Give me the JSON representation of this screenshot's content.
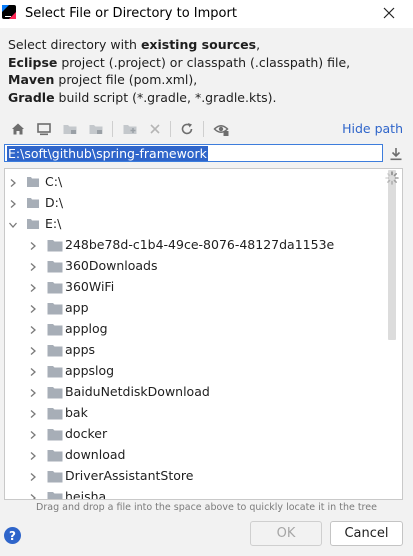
{
  "window": {
    "title": "Select File or Directory to Import"
  },
  "description": {
    "line1_pre": "Select directory with ",
    "line1_bold": "existing sources",
    "line1_post": ",",
    "line2_bold": "Eclipse",
    "line2_post": " project (.project) or classpath (.classpath) file,",
    "line3_bold": "Maven",
    "line3_post": " project file (pom.xml),",
    "line4_bold": "Gradle",
    "line4_post": " build script (*.gradle, *.gradle.kts)."
  },
  "toolbar": {
    "icons": [
      "home-icon",
      "desktop-icon",
      "project-folder-icon",
      "module-folder-icon",
      "new-folder-icon",
      "delete-icon",
      "refresh-icon",
      "show-hidden-icon"
    ],
    "hide_path_label": "Hide path"
  },
  "path_field": {
    "value": "E:\\soft\\github\\spring-framework"
  },
  "tree": {
    "drives": [
      {
        "label": "C:\\",
        "expanded": false
      },
      {
        "label": "D:\\",
        "expanded": false
      },
      {
        "label": "E:\\",
        "expanded": true
      }
    ],
    "folders": [
      "248be78d-c1b4-49ce-8076-48127da1153e",
      "360Downloads",
      "360WiFi",
      "app",
      "applog",
      "apps",
      "appslog",
      "BaiduNetdiskDownload",
      "bak",
      "docker",
      "download",
      "DriverAssistantStore",
      "heisha"
    ]
  },
  "hint": "Drag and drop a file into the space above to quickly locate it in the tree",
  "footer": {
    "help_label": "?",
    "ok_label": "OK",
    "cancel_label": "Cancel"
  },
  "colors": {
    "accent": "#2f65ca",
    "folder": "#a7aeb7",
    "background": "#f2f2f2"
  }
}
